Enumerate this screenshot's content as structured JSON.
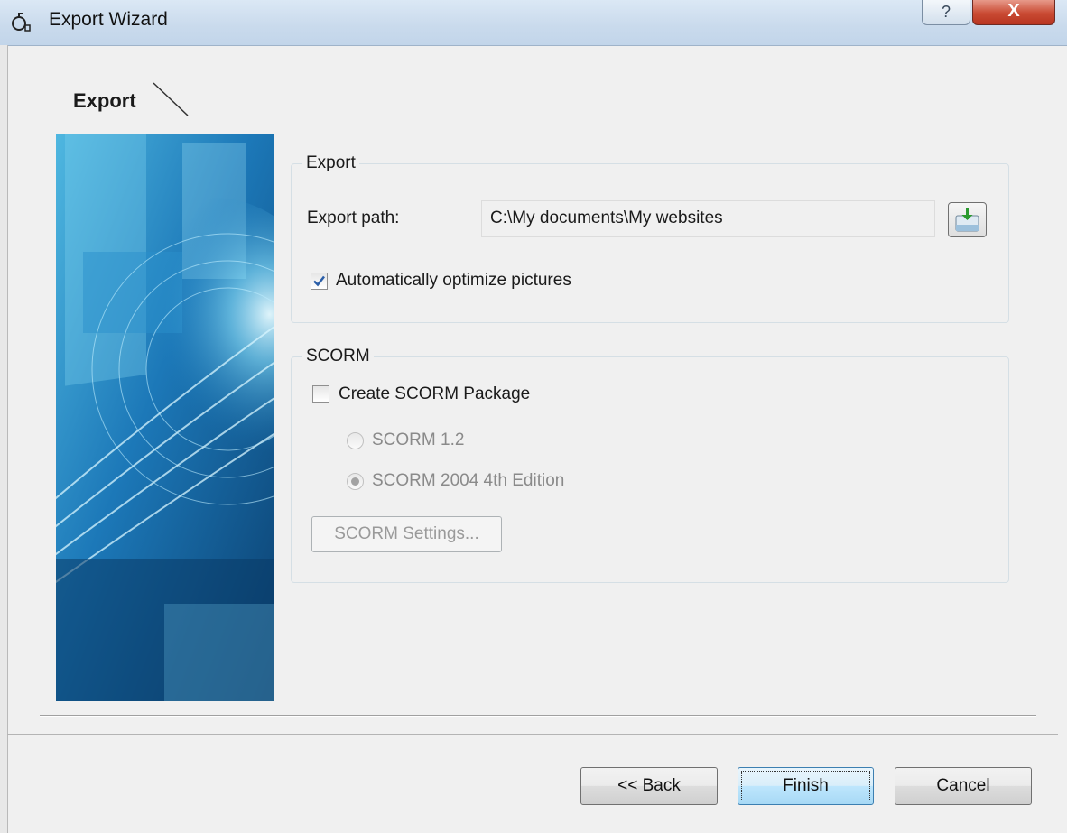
{
  "window": {
    "title": "Export Wizard",
    "help_label": "?",
    "close_label": "X"
  },
  "page": {
    "heading": "Export"
  },
  "export_group": {
    "legend": "Export",
    "path_label": "Export path:",
    "path_value": "C:\\My documents\\My websites",
    "optimize_label": "Automatically optimize pictures",
    "optimize_checked": true
  },
  "scorm_group": {
    "legend": "SCORM",
    "create_label": "Create SCORM Package",
    "create_checked": false,
    "radio_options": [
      {
        "label": "SCORM 1.2",
        "selected": false
      },
      {
        "label": "SCORM 2004 4th Edition",
        "selected": true
      }
    ],
    "settings_button": "SCORM Settings..."
  },
  "footer": {
    "back_button": "<< Back",
    "finish_button": "Finish",
    "cancel_button": "Cancel"
  },
  "colors": {
    "check_blue": "#2a5ea8",
    "banner_dark": "#0b3f6e",
    "banner_light": "#6fd3f5"
  }
}
